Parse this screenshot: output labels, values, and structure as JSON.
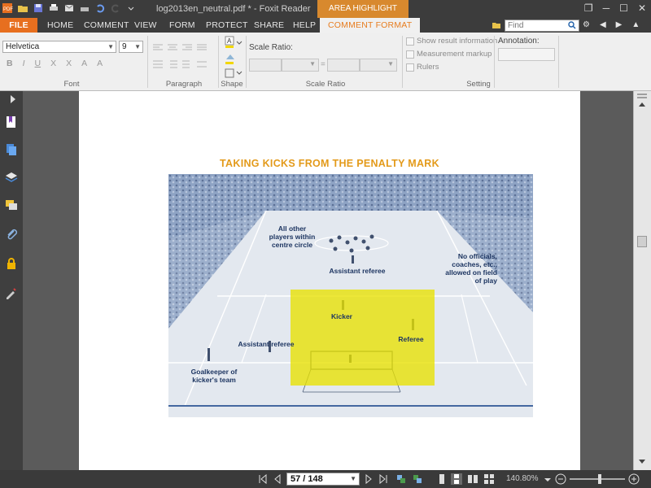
{
  "titlebar": {
    "document_title": "log2013en_neutral.pdf * - Foxit Reader",
    "context_tab": "AREA HIGHLIGHT TOOL"
  },
  "menu": {
    "file": "FILE",
    "tabs": [
      "HOME",
      "COMMENT",
      "VIEW",
      "FORM",
      "PROTECT",
      "SHARE",
      "HELP"
    ],
    "active_tab": "COMMENT FORMAT",
    "find_placeholder": "Find"
  },
  "ribbon": {
    "font_name": "Helvetica",
    "font_size": "9",
    "scale_ratio_label": "Scale Ratio:",
    "annotation_label": "Annotation:",
    "checkboxes": [
      "Show result information",
      "Measurement markup",
      "Rulers"
    ],
    "group_labels": {
      "font": "Font",
      "paragraph": "Paragraph",
      "shape": "Shape",
      "scale": "Scale Ratio",
      "setting": "Setting"
    },
    "format_buttons": [
      "B",
      "I",
      "U",
      "X",
      "X",
      "A",
      "A"
    ]
  },
  "document": {
    "heading": "TAKING KICKS FROM THE PENALTY MARK",
    "figure_labels": {
      "other_players": "All other\nplayers within\ncentre circle",
      "assistant_referee_top": "Assistant referee",
      "no_officials": "No officials,\ncoaches, etc.,\nallowed on field\nof play",
      "kicker": "Kicker",
      "referee": "Referee",
      "assistant_referee_left": "Assistant referee",
      "goalkeeper": "Goalkeeper of\nkicker's team"
    }
  },
  "statusbar": {
    "page_indicator": "57 / 148",
    "zoom": "140.80%"
  },
  "colors": {
    "accent": "#e76f1f",
    "context_tab": "#d8892e",
    "highlight": "#e8e200",
    "heading": "#e39a1a"
  }
}
